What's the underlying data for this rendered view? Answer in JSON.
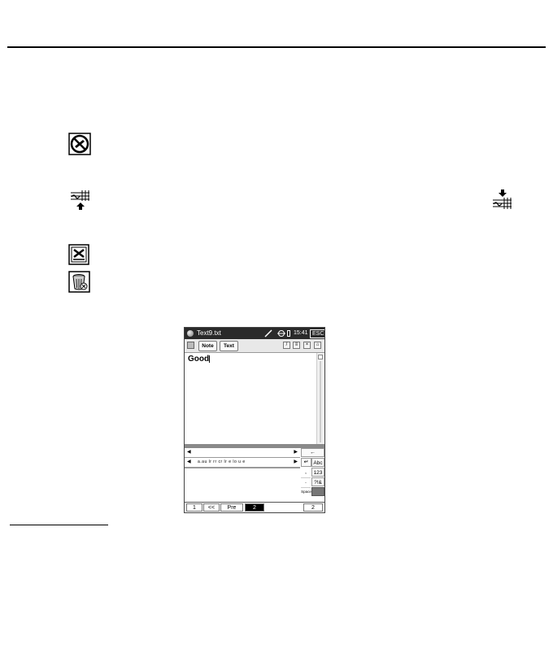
{
  "device": {
    "titlebar": {
      "filename": "Text9.txt",
      "time": "15:41",
      "esc_label": "ESC"
    },
    "toolbar": {
      "note_label": "Note",
      "text_label": "Text"
    },
    "document_text": "Good",
    "candidate_text": "a.au  lr  rr  cr  lr  e  lo  u  e",
    "buttons": {
      "backspace": "←",
      "enter": "↵",
      "abc": "Abc",
      "num": "123",
      "sym": "?!&",
      "space": "Space"
    },
    "punct": [
      ",",
      "."
    ],
    "pager": {
      "first": "1",
      "back": "<<",
      "prev": "Pre",
      "current": "2",
      "last": "2"
    }
  },
  "icon_names": [
    "no-writing-icon",
    "move-up-icon",
    "move-down-icon",
    "delete-page-icon",
    "trash-can-icon"
  ]
}
